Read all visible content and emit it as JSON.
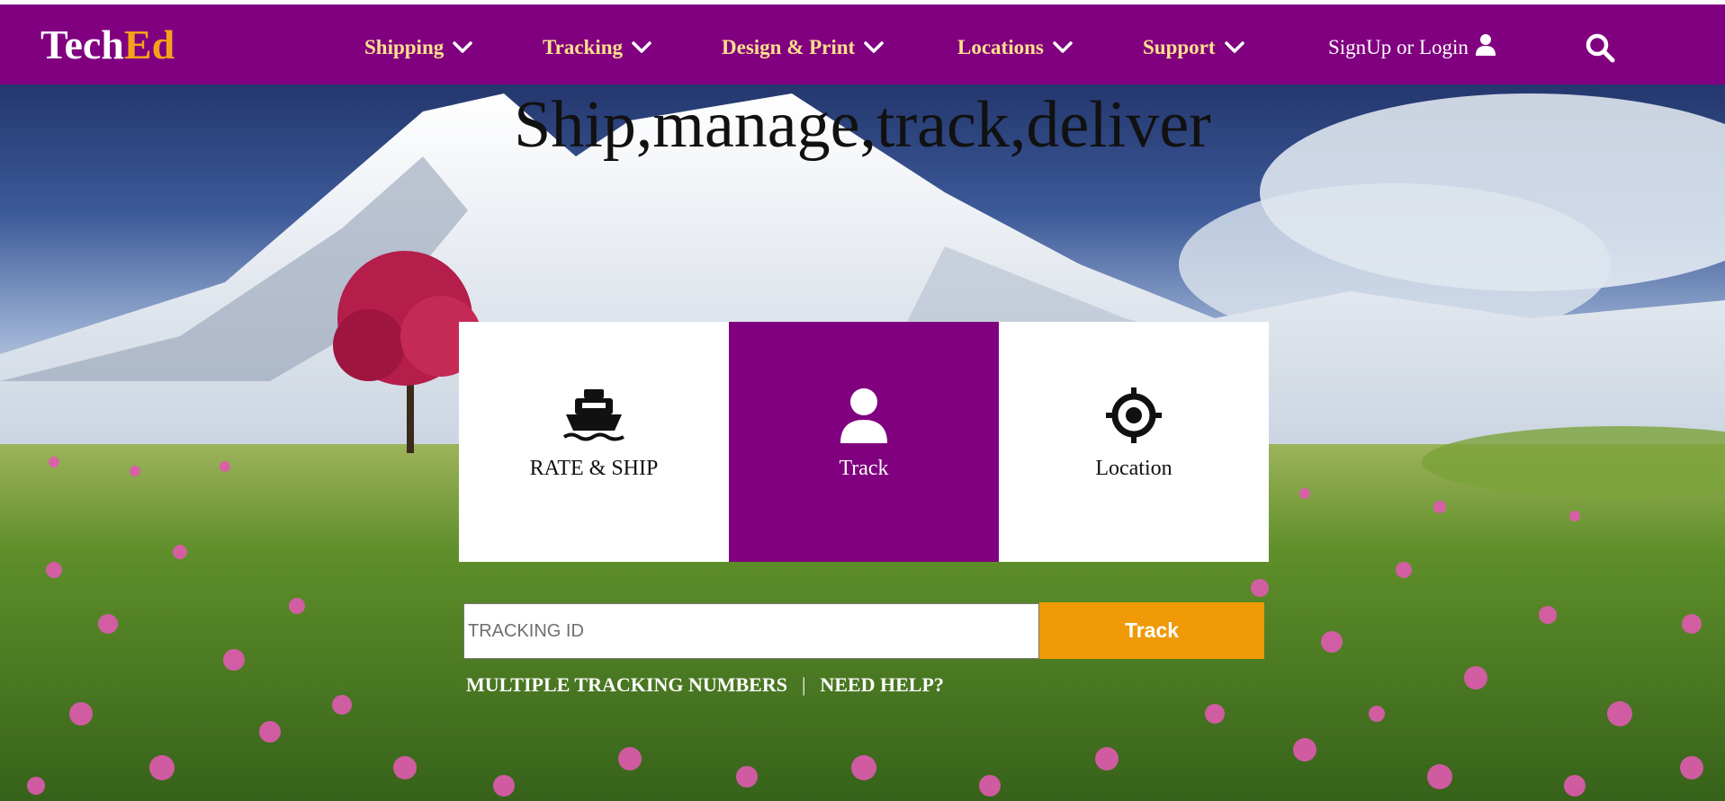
{
  "brand": {
    "part1": "Tech",
    "part2": "Ed",
    "colors": {
      "navbar": "#800080",
      "accent": "#f5a21a",
      "nav_text": "#ffe08c",
      "track_button": "#ef9a06"
    }
  },
  "nav": {
    "items": [
      {
        "label": "Shipping",
        "icon": "chevron-down-icon"
      },
      {
        "label": "Tracking",
        "icon": "chevron-down-icon"
      },
      {
        "label": "Design & Print",
        "icon": "chevron-down-icon"
      },
      {
        "label": "Locations",
        "icon": "chevron-down-icon"
      },
      {
        "label": "Support",
        "icon": "chevron-down-icon"
      }
    ],
    "signup_label": "SignUp or Login",
    "signup_icon": "user-icon",
    "search_icon": "search-icon"
  },
  "hero": {
    "headline": "Ship,manage,track,deliver",
    "cards": [
      {
        "label": "RATE & SHIP",
        "icon": "ship-icon",
        "active": false
      },
      {
        "label": "Track",
        "icon": "user-icon",
        "active": true
      },
      {
        "label": "Location",
        "icon": "location-target-icon",
        "active": false
      }
    ],
    "tracking": {
      "placeholder": "TRACKING ID",
      "value": "",
      "button_label": "Track"
    },
    "links": {
      "multiple": "MULTIPLE TRACKING NUMBERS",
      "separator": "|",
      "help": "NEED HELP?"
    }
  }
}
